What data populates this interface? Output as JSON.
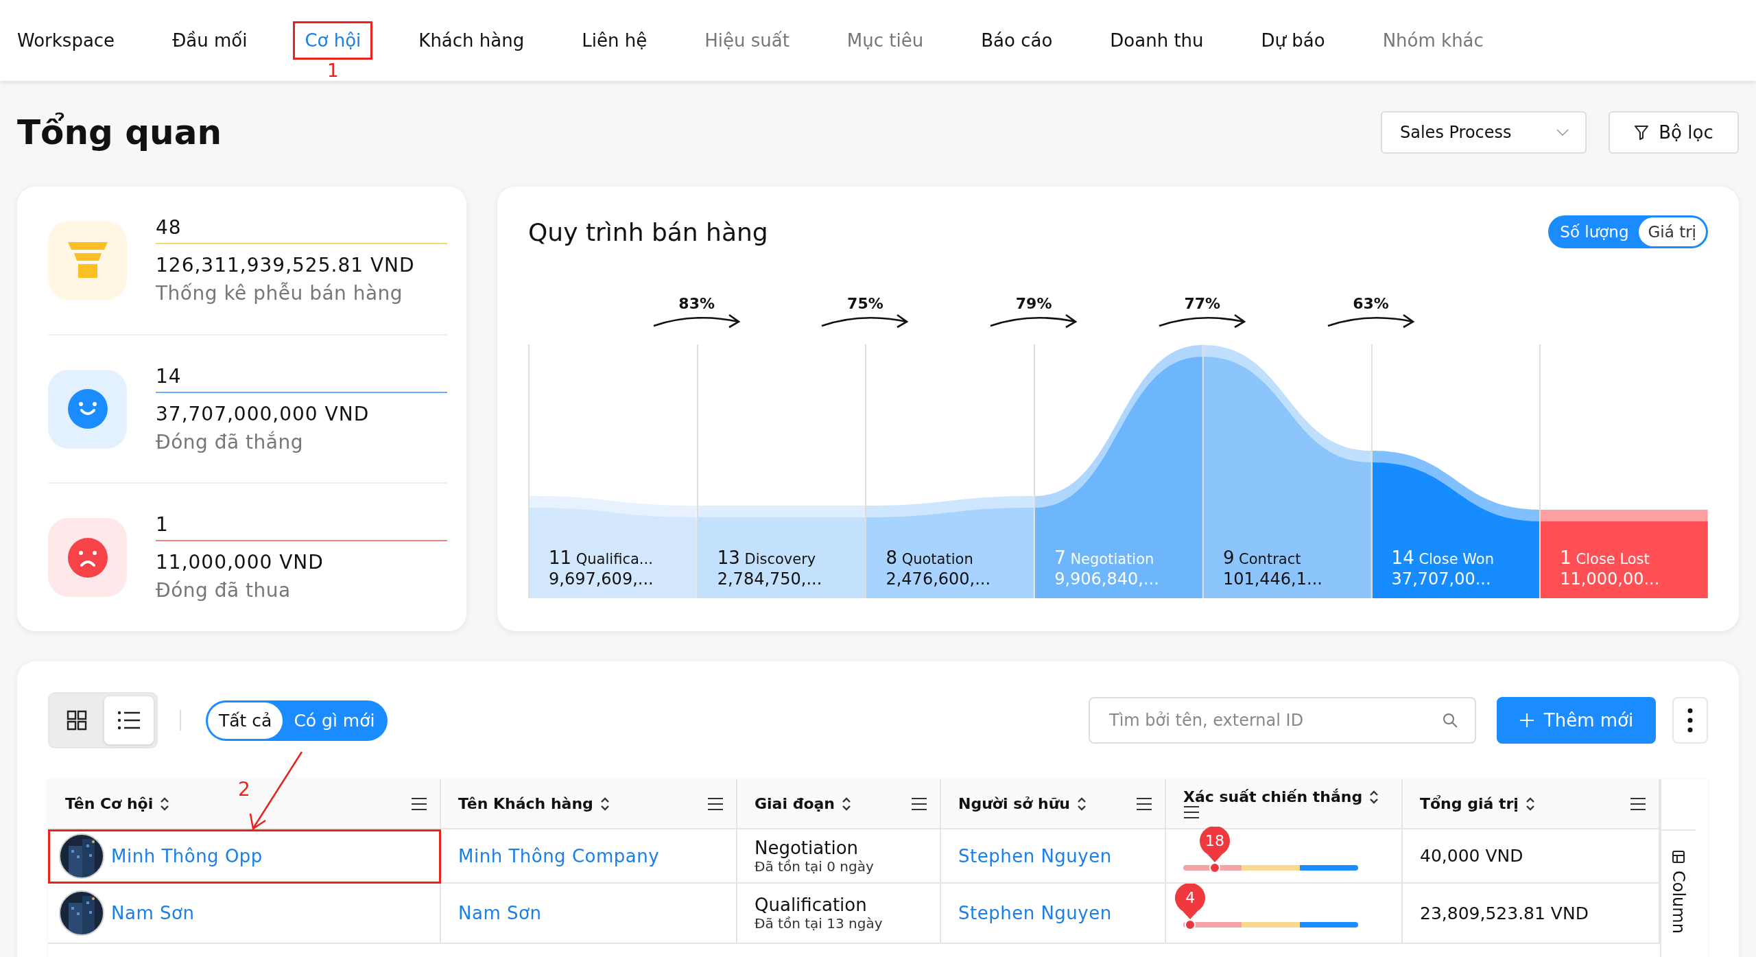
{
  "nav": [
    {
      "label": "Workspace",
      "selected": false,
      "disabled": false
    },
    {
      "label": "Đầu mối",
      "selected": false,
      "disabled": false
    },
    {
      "label": "Cơ hội",
      "selected": true,
      "disabled": false,
      "marker": "1"
    },
    {
      "label": "Khách hàng",
      "selected": false,
      "disabled": false
    },
    {
      "label": "Liên hệ",
      "selected": false,
      "disabled": false
    },
    {
      "label": "Hiệu suất",
      "selected": false,
      "disabled": true
    },
    {
      "label": "Mục tiêu",
      "selected": false,
      "disabled": true
    },
    {
      "label": "Báo cáo",
      "selected": false,
      "disabled": false
    },
    {
      "label": "Doanh thu",
      "selected": false,
      "disabled": false
    },
    {
      "label": "Dự báo",
      "selected": false,
      "disabled": false
    },
    {
      "label": "Nhóm khác",
      "selected": false,
      "disabled": true
    }
  ],
  "page_title": "Tổng quan",
  "process_select": {
    "value": "Sales Process"
  },
  "filter_button": "Bộ lọc",
  "summary": [
    {
      "kind": "funnel",
      "count": "48",
      "amount": "126,311,939,525.81 VND",
      "label": "Thống kê phễu bán hàng",
      "color": "#fbbf24"
    },
    {
      "kind": "won",
      "count": "14",
      "amount": "37,707,000,000 VND",
      "label": "Đóng đã thắng",
      "color": "#1a8cff"
    },
    {
      "kind": "lost",
      "count": "1",
      "amount": "11,000,000 VND",
      "label": "Đóng đã thua",
      "color": "#f64348"
    }
  ],
  "funnel": {
    "title": "Quy trình bán hàng",
    "modes": [
      {
        "label": "Số lượng",
        "selected": false
      },
      {
        "label": "Giá trị",
        "selected": true
      }
    ],
    "conversions": [
      "83%",
      "75%",
      "79%",
      "77%",
      "63%"
    ],
    "stages": [
      {
        "count": "11",
        "name": "Qualifica...",
        "value": "9,697,609,...",
        "color": "#d3e8fd"
      },
      {
        "count": "13",
        "name": "Discovery",
        "value": "2,784,750,...",
        "color": "#c3e0fd"
      },
      {
        "count": "8",
        "name": "Quotation",
        "value": "2,476,600,...",
        "color": "#a8d3fe"
      },
      {
        "count": "7",
        "name": "Negotiation",
        "value": "9,906,840,...",
        "color": "#6eb6fc"
      },
      {
        "count": "9",
        "name": "Contract",
        "value": "101,446,1...",
        "color": "#8bc5fc"
      },
      {
        "count": "14",
        "name": "Close Won",
        "value": "37,707,00...",
        "color": "#178cfe"
      },
      {
        "count": "1",
        "name": "Close Lost",
        "value": "11,000,00...",
        "color": "#fe5055"
      }
    ]
  },
  "table": {
    "view_modes": [
      {
        "kind": "grid",
        "selected": false
      },
      {
        "kind": "list",
        "selected": true
      }
    ],
    "filters": [
      {
        "label": "Tất cả",
        "selected": true
      },
      {
        "label": "Có gì mới",
        "selected": false
      }
    ],
    "search": {
      "placeholder": "Tìm bởi tên, external ID"
    },
    "add_button": "Thêm mới",
    "columns": [
      {
        "label": "Tên Cơ hội"
      },
      {
        "label": "Tên Khách hàng"
      },
      {
        "label": "Giai đoạn"
      },
      {
        "label": "Người sở hữu"
      },
      {
        "label": "Xác suất chiến thắng"
      },
      {
        "label": "Tổng giá trị"
      }
    ],
    "side_panel": "Column",
    "rows": [
      {
        "opportunity": "Minh Thông Opp",
        "customer": "Minh Thông Company",
        "stage": "Negotiation",
        "stage_age": "Đã tồn tại 0 ngày",
        "owner": "Stephen Nguyen",
        "win_probability": "18",
        "level": 0.18,
        "total": "40,000 VND",
        "marker": "2"
      },
      {
        "opportunity": "Nam Sơn",
        "customer": "Nam Sơn",
        "stage": "Qualification",
        "stage_age": "Đã tồn tại 13 ngày",
        "owner": "Stephen Nguyen",
        "win_probability": "4",
        "level": 0.04,
        "total": "23,809,523.81 VND"
      }
    ]
  }
}
